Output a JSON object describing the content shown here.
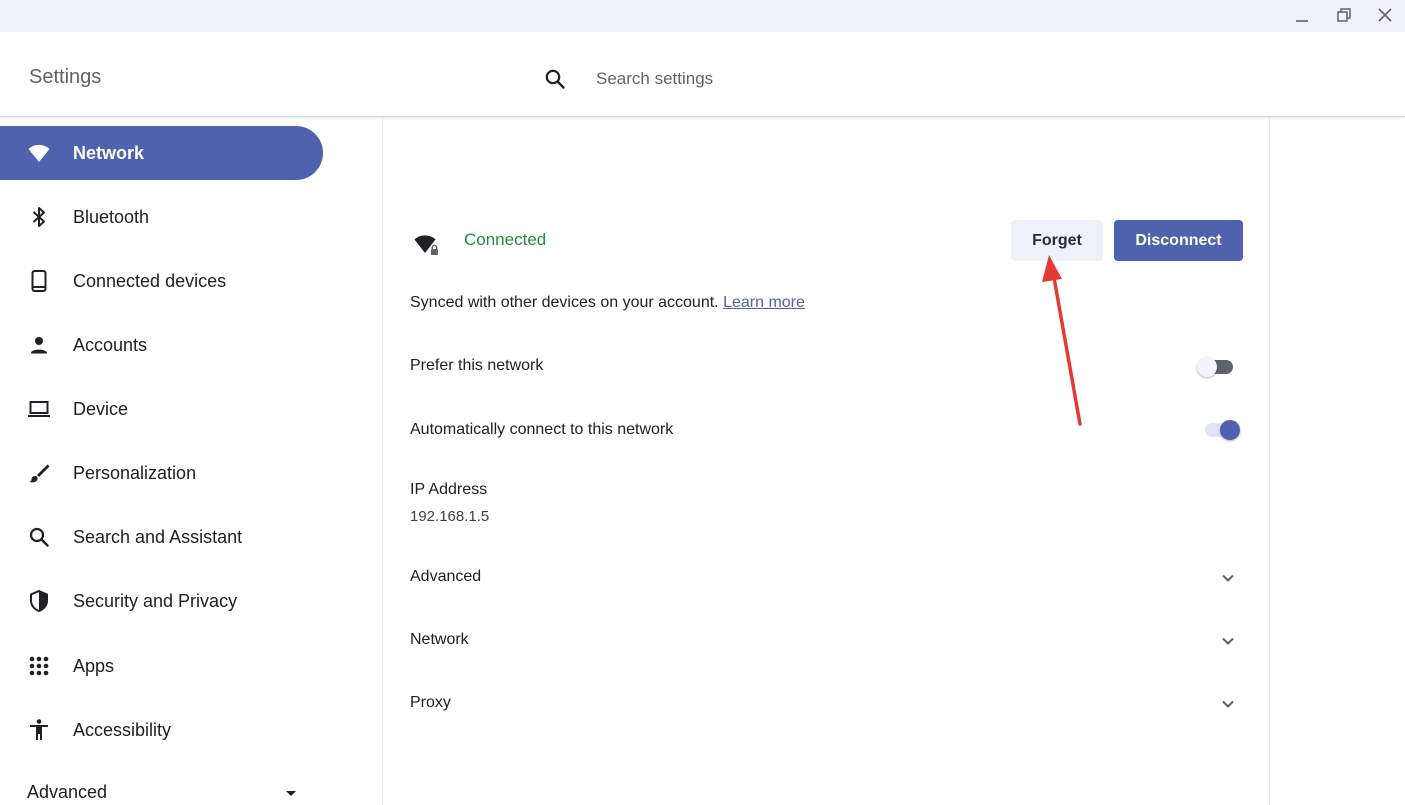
{
  "window": {
    "controls": [
      {
        "name": "minimize",
        "icon": "minimize-icon"
      },
      {
        "name": "restore",
        "icon": "restore-icon"
      },
      {
        "name": "close",
        "icon": "close-icon"
      }
    ]
  },
  "header": {
    "title": "Settings",
    "search_placeholder": "Search settings",
    "search_value": ""
  },
  "sidebar": {
    "items": [
      {
        "label": "Network",
        "icon": "wifi-icon",
        "active": true
      },
      {
        "label": "Bluetooth",
        "icon": "bluetooth-icon"
      },
      {
        "label": "Connected devices",
        "icon": "phone-icon"
      },
      {
        "label": "Accounts",
        "icon": "person-icon"
      },
      {
        "label": "Device",
        "icon": "laptop-icon"
      },
      {
        "label": "Personalization",
        "icon": "brush-icon"
      },
      {
        "label": "Search and Assistant",
        "icon": "search-icon"
      },
      {
        "label": "Security and Privacy",
        "icon": "shield-icon"
      },
      {
        "label": "Apps",
        "icon": "apps-grid-icon"
      },
      {
        "label": "Accessibility",
        "icon": "accessibility-icon"
      }
    ],
    "advanced_label": "Advanced"
  },
  "network_detail": {
    "status": "Connected",
    "forget_label": "Forget",
    "disconnect_label": "Disconnect",
    "synced_text": "Synced with other devices on your account.",
    "learn_more": "Learn more",
    "prefer_label": "Prefer this network",
    "prefer_enabled": false,
    "autoconnect_label": "Automatically connect to this network",
    "autoconnect_enabled": true,
    "ip_label": "IP Address",
    "ip_value": "192.168.1.5",
    "sections": [
      "Advanced",
      "Network",
      "Proxy"
    ]
  },
  "colors": {
    "accent": "#4e62ad",
    "connected": "#1e8e3e",
    "annotation_arrow": "#e53935"
  }
}
